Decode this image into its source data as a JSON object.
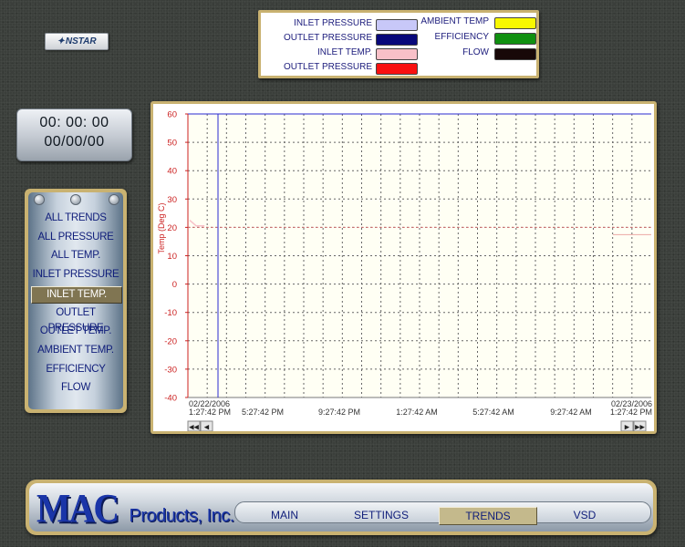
{
  "logo": {
    "text": "NSTAR",
    "icon": "star-icon"
  },
  "legend": {
    "items": [
      {
        "label": "INLET PRESSURE",
        "color": "#c8c8f8"
      },
      {
        "label": "OUTLET PRESSURE",
        "color": "#08087a"
      },
      {
        "label": "INLET TEMP.",
        "color": "#f8c0c8"
      },
      {
        "label": "OUTLET PRESSURE",
        "color": "#f81010"
      },
      {
        "label": "AMBIENT TEMP",
        "color": "#f8f800"
      },
      {
        "label": "EFFICIENCY",
        "color": "#109010"
      },
      {
        "label": "FLOW",
        "color": "#180808"
      }
    ]
  },
  "clock": {
    "time": "00: 00: 00",
    "date": "00/00/00"
  },
  "menu": {
    "selected_index": 4,
    "items": [
      "ALL TRENDS",
      "ALL PRESSURE",
      "ALL TEMP.",
      "INLET PRESSURE",
      "INLET TEMP.",
      "OUTLET PRESSURE",
      "OUTLET TEMP.",
      "AMBIENT TEMP.",
      "EFFICIENCY",
      "FLOW"
    ]
  },
  "chart_data": {
    "type": "line",
    "ylabel": "Temp (Deg C)",
    "ylim": [
      -40,
      60
    ],
    "y_ticks": [
      60,
      50,
      40,
      30,
      20,
      10,
      0,
      -10,
      -20,
      -30,
      -40
    ],
    "grid": true,
    "x_tick_labels": [
      [
        "02/22/2006",
        "1:27:42 PM"
      ],
      [
        "",
        "5:27:42 PM"
      ],
      [
        "",
        "9:27:42 PM"
      ],
      [
        "",
        "1:27:42 AM"
      ],
      [
        "",
        "5:27:42 AM"
      ],
      [
        "",
        "9:27:42 AM"
      ],
      [
        "02/23/2006",
        "1:27:42 PM"
      ]
    ],
    "series": [
      {
        "values": [
          22.5,
          22.0,
          21.5,
          21.0,
          20.5,
          20.5,
          20.5,
          20.5,
          20.5,
          20.5
        ],
        "color": "#f8c0c8"
      }
    ],
    "reference_line": {
      "value": 20,
      "color": "#e07070"
    },
    "axis_color": "#cc2222",
    "cursor_color": "#2b2bd0",
    "scroll_icons": [
      "rewind-icon",
      "step-back-icon",
      "step-forward-icon",
      "fast-forward-icon"
    ]
  },
  "nav": {
    "brand_main": "MAC",
    "brand_sub": "Products, Inc.",
    "selected_index": 2,
    "items": [
      "MAIN",
      "SETTINGS",
      "TRENDS",
      "VSD"
    ]
  }
}
